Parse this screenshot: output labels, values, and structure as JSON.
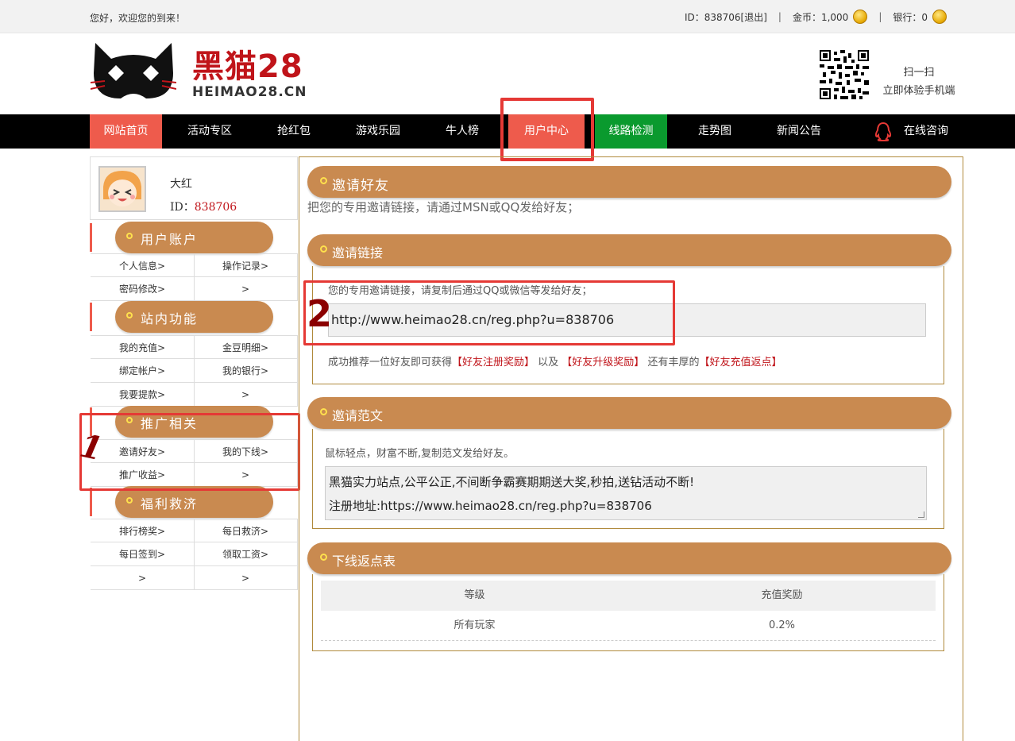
{
  "topbar": {
    "welcome": "您好，欢迎您的到来！",
    "id_text": "ID：838706[退出]",
    "coins_text": "金币：1,000",
    "bank_text": "银行：0"
  },
  "logo": {
    "cn": "黑猫28",
    "en": "HEIMAO28.CN"
  },
  "qr": {
    "line1": "扫一扫",
    "line2": "立即体验手机端"
  },
  "nav": {
    "items": [
      "网站首页",
      "活动专区",
      "抢红包",
      "游戏乐园",
      "牛人榜",
      "用户中心",
      "线路检测",
      "走势图",
      "新闻公告"
    ],
    "consult": "在线咨询"
  },
  "profile": {
    "name": "大红",
    "id_label": "ID：",
    "id_value": "838706"
  },
  "sidebar": {
    "sections": [
      {
        "title": "用户账户",
        "items": [
          "个人信息>",
          "操作记录>",
          "密码修改>",
          ">"
        ]
      },
      {
        "title": "站内功能",
        "items": [
          "我的充值>",
          "金豆明细>",
          "绑定帐户>",
          "我的银行>",
          "我要提款>",
          ">"
        ]
      },
      {
        "title": "推广相关",
        "items": [
          "邀请好友>",
          "我的下线>",
          "推广收益>",
          ">"
        ]
      },
      {
        "title": "福利救济",
        "items": [
          "排行榜奖>",
          "每日救济>",
          "每日签到>",
          "领取工资>",
          ">",
          ">"
        ]
      }
    ]
  },
  "main": {
    "invite_title": "邀请好友",
    "invite_desc": "把您的专用邀请链接，请通过MSN或QQ发给好友；",
    "link_title": "邀请链接",
    "link_tip": "您的专用邀请链接，请复制后通过QQ或微信等发给好友；",
    "link_url": "http://www.heimao28.cn/reg.php?u=838706",
    "reward_pre": "成功推荐一位好友即可获得",
    "reward_1": "【好友注册奖励】",
    "reward_mid1": " 以及 ",
    "reward_2": "【好友升级奖励】",
    "reward_mid2": " 还有丰厚的",
    "reward_3": "【好友充值返点】",
    "sample_title": "邀请范文",
    "sample_tip": "鼠标轻点，财富不断,复制范文发给好友。",
    "sample_line1": "黑猫实力站点,公平公正,不间断争霸赛期期送大奖,秒拍,送钻活动不断!",
    "sample_line2": "注册地址:https://www.heimao28.cn/reg.php?u=838706",
    "rebate_title": "下线返点表",
    "rebate_headers": [
      "等级",
      "充值奖励"
    ],
    "rebate_rows": [
      [
        "所有玩家",
        "0.2%"
      ]
    ]
  },
  "annotations": {
    "mark1": "1",
    "mark2": "2"
  },
  "colors": {
    "accent": "#ee5b4c",
    "pill": "#c98a50",
    "brand_red": "#c0141a",
    "nav_green": "#0a9a2e"
  }
}
